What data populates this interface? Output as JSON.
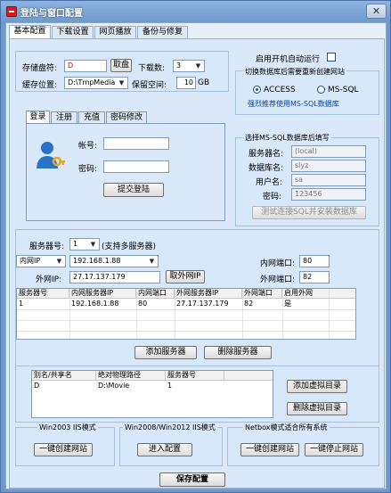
{
  "window": {
    "title": "登陆与窗口配置",
    "close_glyph": "✕"
  },
  "tabs": [
    {
      "label": "基本配置",
      "selected": true
    },
    {
      "label": "下载设置",
      "selected": false
    },
    {
      "label": "网页播放",
      "selected": false
    },
    {
      "label": "备份与修复",
      "selected": false
    }
  ],
  "storage": {
    "drive_label": "存储盘符:",
    "drive_value": "D",
    "drive_button": "取盘",
    "download_count_label": "下载数:",
    "download_count_value": "3",
    "cache_label": "缓存位置:",
    "cache_value": "D:\\TmpMedia",
    "reserve_label": "保留空间:",
    "reserve_value": "10",
    "reserve_unit": "GB"
  },
  "startup": {
    "autorun_label": "启用开机自动运行",
    "autorun_checked": false
  },
  "db_switch": {
    "group_title": "切换数据库后需要重新创建网站",
    "access_label": "ACCESS",
    "mssql_label": "MS-SQL",
    "selected": "ACCESS",
    "recommend_link": "强烈推荐使用MS-SQL数据库"
  },
  "login_tabs": [
    {
      "label": "登录",
      "selected": true
    },
    {
      "label": "注册",
      "selected": false
    },
    {
      "label": "充值",
      "selected": false
    },
    {
      "label": "密码修改",
      "selected": false
    }
  ],
  "login": {
    "account_label": "帐号:",
    "account_value": "",
    "password_label": "密码:",
    "password_value": "",
    "submit_button": "提交登陆",
    "avatar_icon": "user-key-icon"
  },
  "mssql": {
    "group_title": "选择MS-SQL数据库后填写",
    "server_label": "服务器名:",
    "server_value": "(local)",
    "db_label": "数据库名:",
    "db_value": "slyz",
    "user_label": "用户名:",
    "user_value": "sa",
    "password_label": "密码:",
    "password_value": "123456",
    "test_button": "测试连接SQL并安装数据库"
  },
  "server": {
    "server_no_label": "服务器号:",
    "server_no_value": "1",
    "multi_note": "(支持多服务器)",
    "intranet_type": "内网IP",
    "intranet_ip": "192.168.1.88",
    "intranet_port_label": "内网端口:",
    "intranet_port_value": "80",
    "extranet_label": "外网IP:",
    "extranet_ip": "27.17.137.179",
    "fetch_ip_button": "取外网IP",
    "extranet_port_label": "外网端口:",
    "extranet_port_value": "82",
    "add_button": "添加服务器",
    "delete_button": "删除服务器"
  },
  "server_table": {
    "headers": [
      "服务器号",
      "内网服务器IP",
      "内网端口",
      "外网服务器IP",
      "外网端口",
      "启用外网"
    ],
    "rows": [
      [
        "1",
        "192.168.1.88",
        "80",
        "27.17.137.179",
        "82",
        "是"
      ]
    ]
  },
  "vdir_table": {
    "headers": [
      "别名/共享名",
      "绝对物理路径",
      "服务器号"
    ],
    "rows": [
      [
        "D",
        "D:\\Movie",
        "1"
      ]
    ],
    "add_button": "添加虚拟目录",
    "delete_button": "删除虚拟目录"
  },
  "iis": {
    "win2003_title": "Win2003 IIS模式",
    "win2003_button": "一键创建网站",
    "win2008_title": "Win2008/Win2012 IIS模式",
    "win2008_button": "进入配置",
    "netbox_title": "Netbox模式适合所有系统",
    "netbox_create_button": "一键创建网站",
    "netbox_stop_button": "一键停止网站"
  },
  "footer": {
    "save_button": "保存配置"
  }
}
